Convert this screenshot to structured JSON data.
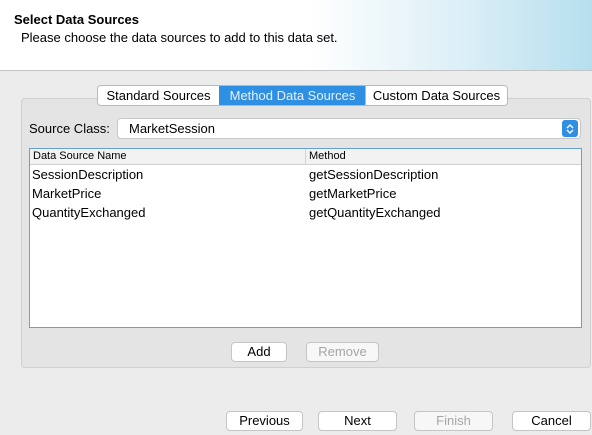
{
  "header": {
    "title": "Select Data Sources",
    "subtitle": "Please choose the data sources to add to this data set."
  },
  "tabs": [
    {
      "label": "Standard Sources",
      "active": false
    },
    {
      "label": "Method Data Sources",
      "active": true
    },
    {
      "label": "Custom Data Sources",
      "active": false
    }
  ],
  "source_class": {
    "label": "Source Class:",
    "value": "MarketSession"
  },
  "table": {
    "columns": [
      "Data Source Name",
      "Method"
    ],
    "rows": [
      [
        "SessionDescription",
        "getSessionDescription"
      ],
      [
        "MarketPrice",
        "getMarketPrice"
      ],
      [
        "QuantityExchanged",
        "getQuantityExchanged"
      ]
    ]
  },
  "actions": {
    "add": "Add",
    "remove": "Remove"
  },
  "footer": {
    "previous": "Previous",
    "next": "Next",
    "finish": "Finish",
    "cancel": "Cancel"
  },
  "colors": {
    "accent": "#2f8fe3",
    "header_gradient_end": "#b6dfee",
    "table_border": "#6a9fd3"
  }
}
